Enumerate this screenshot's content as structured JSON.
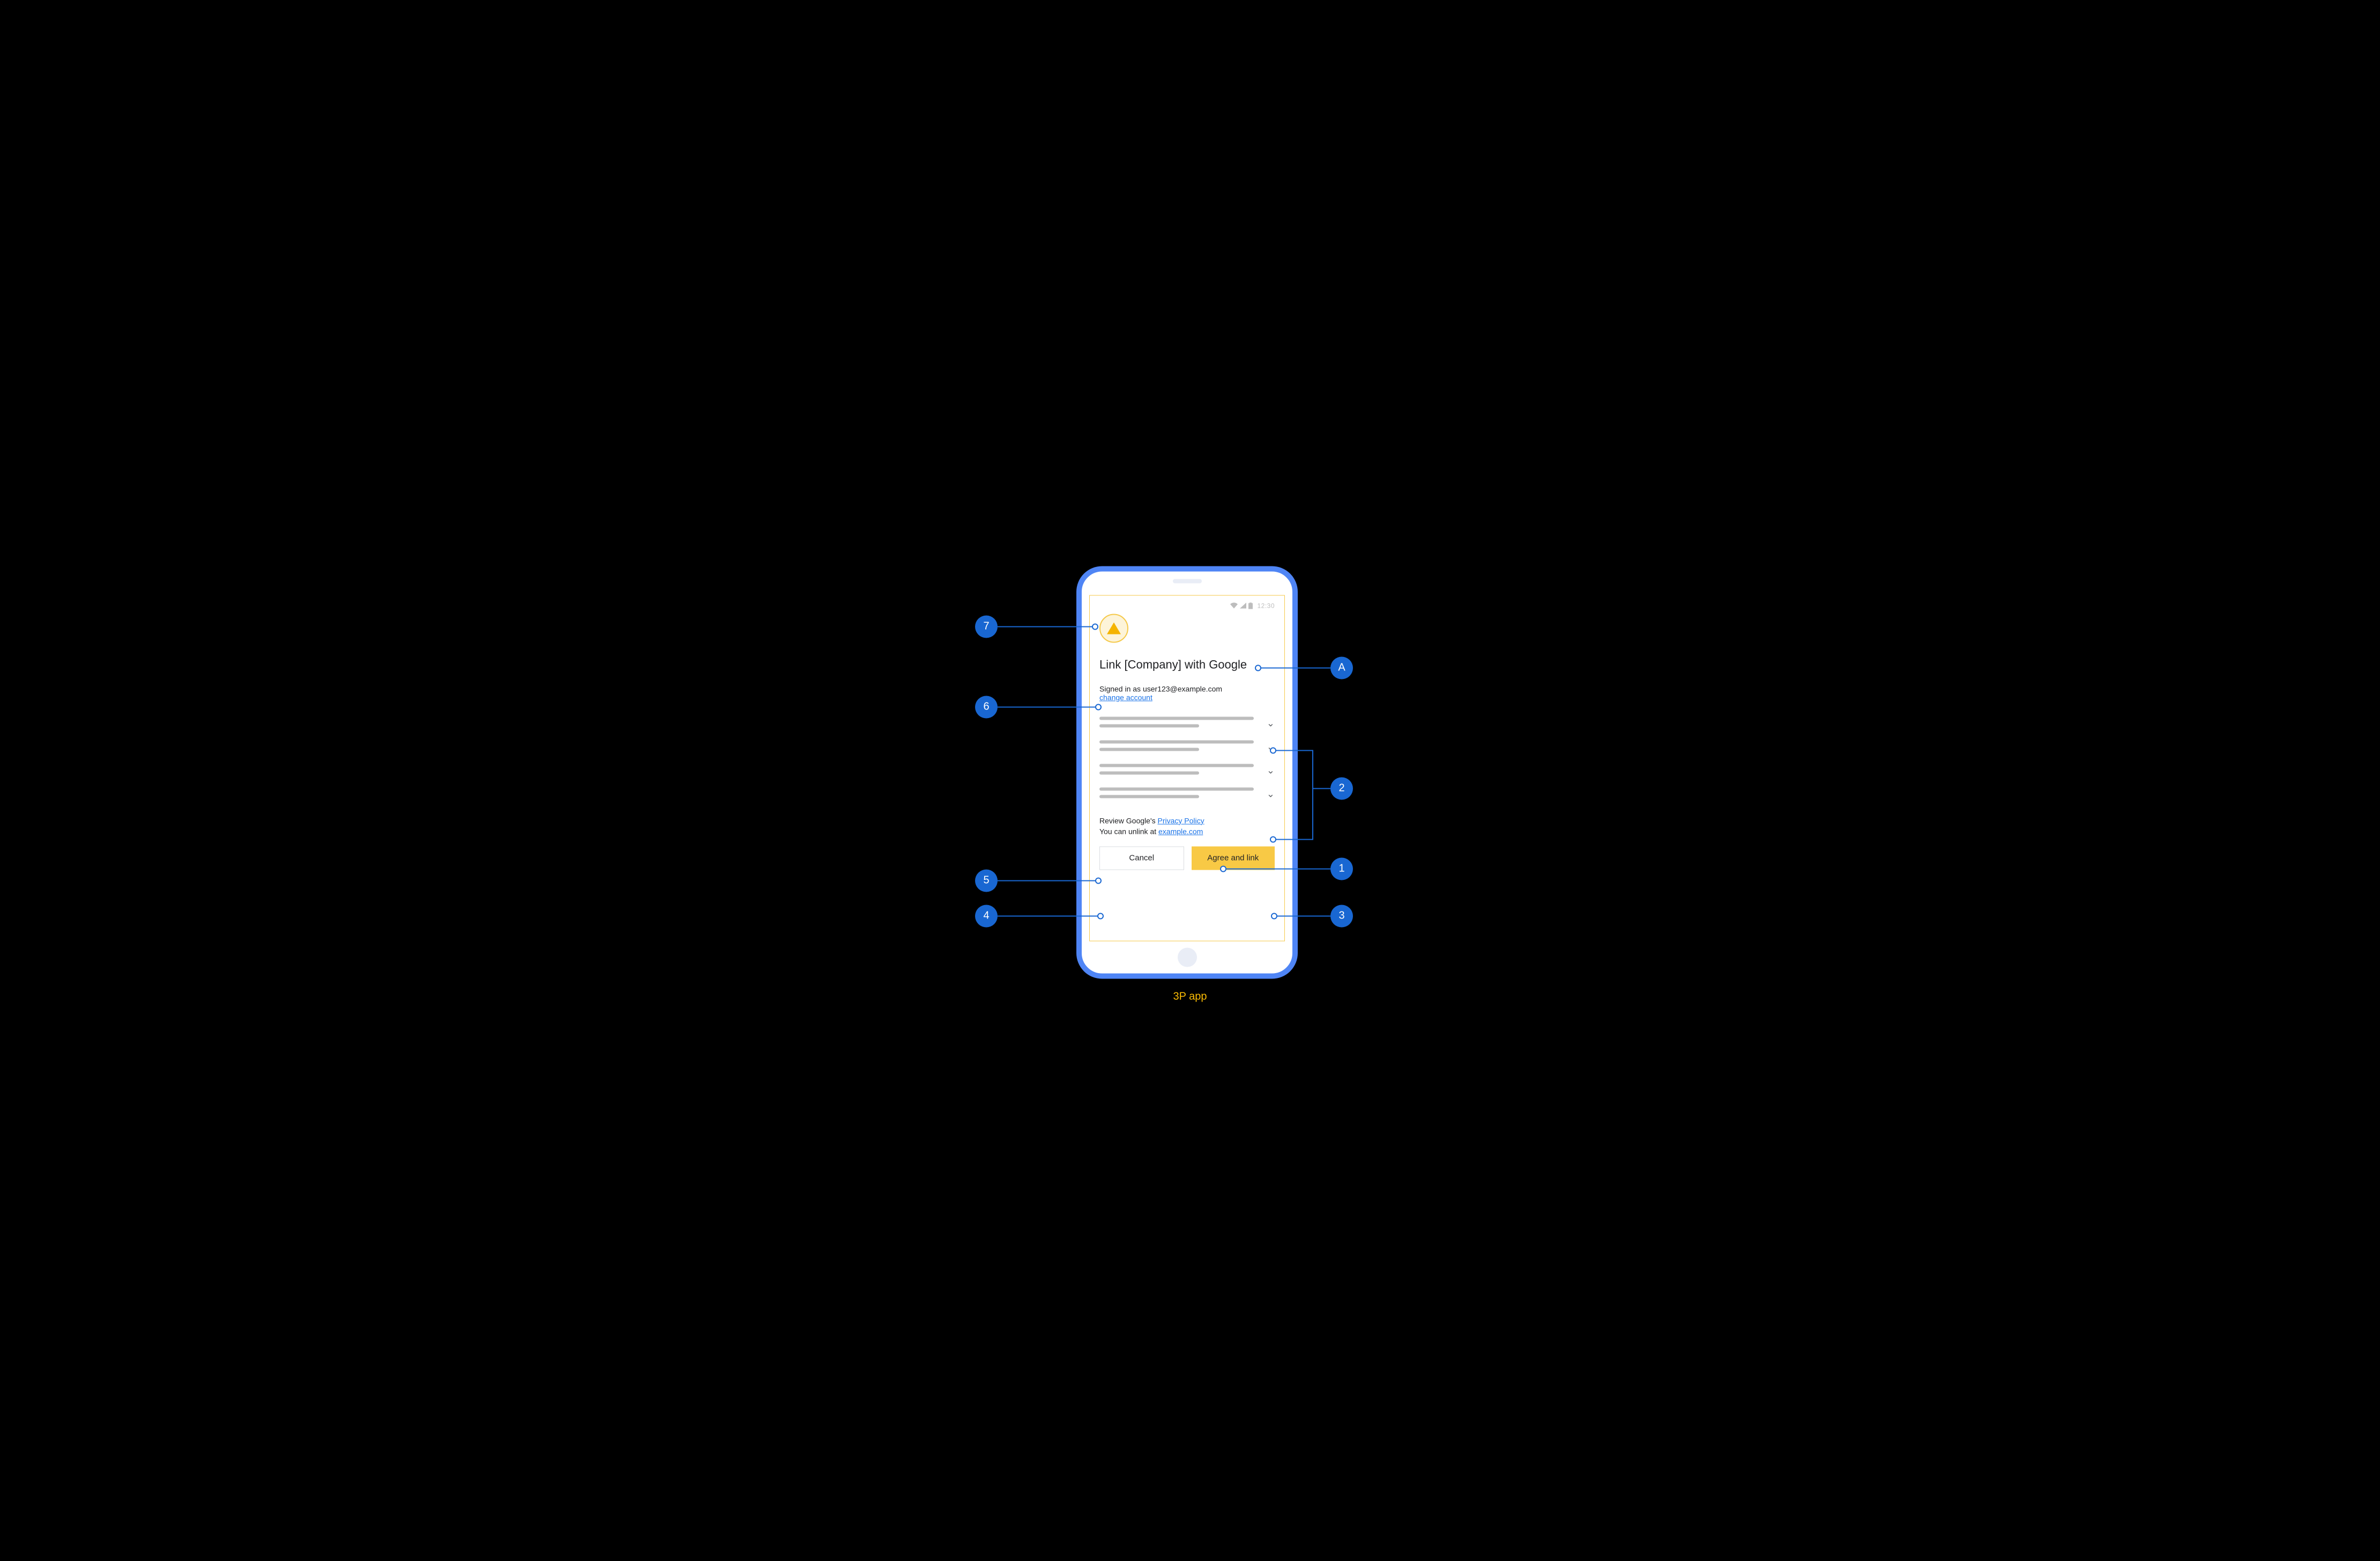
{
  "caption": "3P app",
  "statusbar": {
    "time": "12:30"
  },
  "screen": {
    "title": "Link [Company] with Google",
    "signed_in_prefix": "Signed in as ",
    "email": "user123@example.com",
    "change_account": "change account",
    "privacy_prefix": "Review Google's ",
    "privacy_link": "Privacy Policy",
    "unlink_prefix": "You can unlink at ",
    "unlink_link": "example.com",
    "cancel": "Cancel",
    "agree": "Agree and link"
  },
  "callouts": {
    "c7": "7",
    "c6": "6",
    "c5": "5",
    "c4": "4",
    "cA": "A",
    "c2": "2",
    "c1": "1",
    "c3": "3"
  }
}
